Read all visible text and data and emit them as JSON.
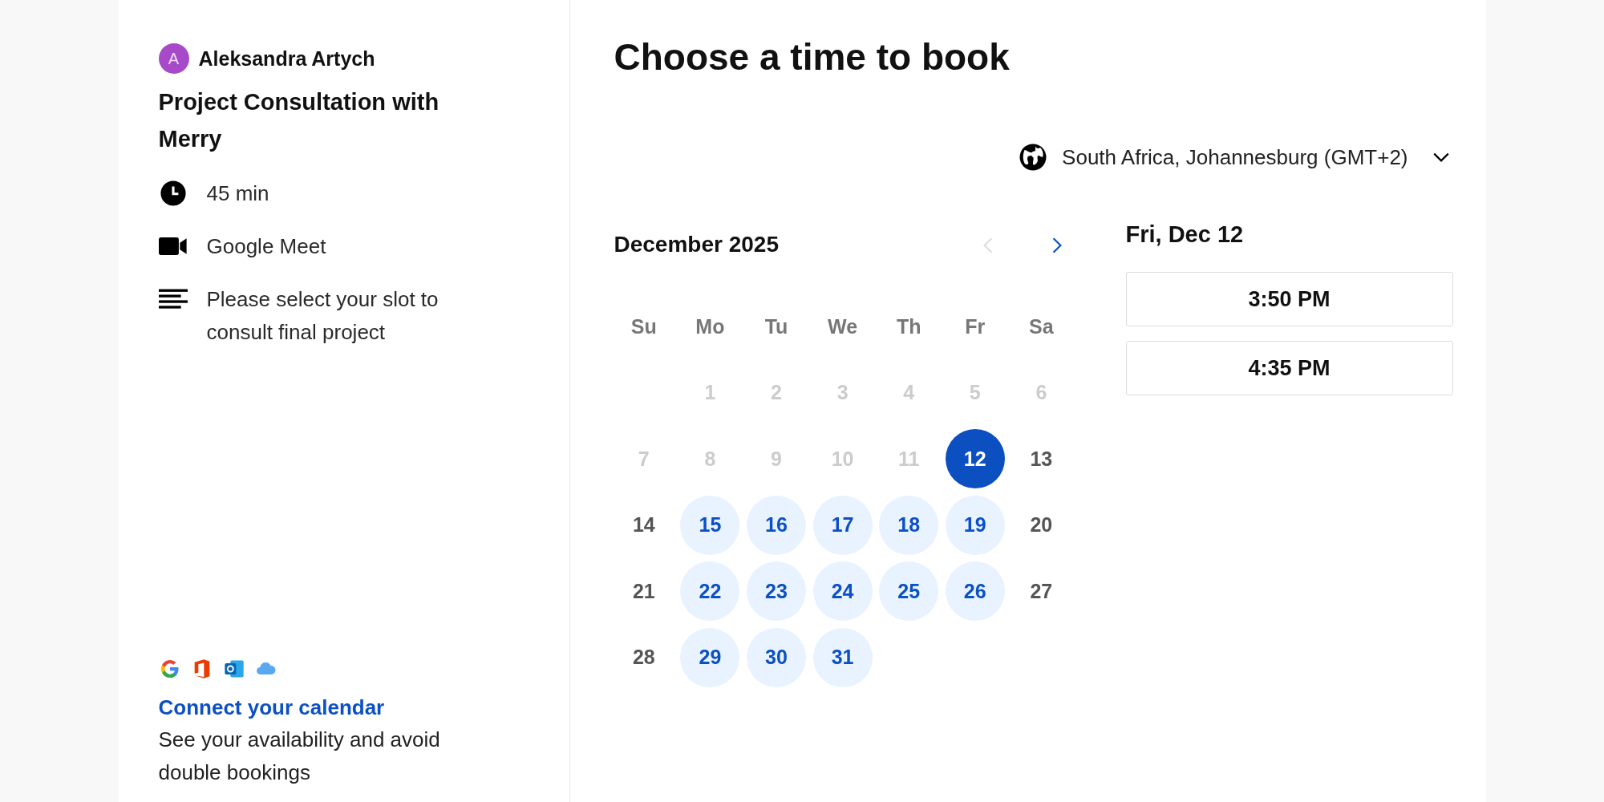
{
  "host": {
    "initial": "A",
    "name": "Aleksandra Artych"
  },
  "event": {
    "title": "Project Consultation with Merry",
    "details": [
      {
        "kind": "duration",
        "text": "45 min"
      },
      {
        "kind": "video",
        "text": "Google Meet"
      },
      {
        "kind": "description",
        "text": "Please select your slot to consult final project"
      }
    ]
  },
  "connect": {
    "link": "Connect your calendar",
    "text": "See your availability and avoid double bookings"
  },
  "heading": "Choose a time to book",
  "timezone": "South Africa, Johannesburg (GMT+2)",
  "calendar": {
    "month": "December 2025",
    "prev_disabled": true,
    "next_disabled": false,
    "weekdays": [
      "Su",
      "Mo",
      "Tu",
      "We",
      "Th",
      "Fr",
      "Sa"
    ],
    "weeks": [
      [
        {
          "kind": "blank"
        },
        {
          "label": "1",
          "kind": "past",
          "selected": false
        },
        {
          "label": "2",
          "kind": "past",
          "selected": false
        },
        {
          "label": "3",
          "kind": "past",
          "selected": false
        },
        {
          "label": "4",
          "kind": "past",
          "selected": false
        },
        {
          "label": "5",
          "kind": "past",
          "selected": false
        },
        {
          "label": "6",
          "kind": "past",
          "selected": false
        }
      ],
      [
        {
          "label": "7",
          "kind": "past",
          "selected": false
        },
        {
          "label": "8",
          "kind": "past",
          "selected": false
        },
        {
          "label": "9",
          "kind": "past",
          "selected": false
        },
        {
          "label": "10",
          "kind": "past",
          "selected": false
        },
        {
          "label": "11",
          "kind": "past",
          "selected": false
        },
        {
          "label": "12",
          "kind": "available",
          "selected": true
        },
        {
          "label": "13",
          "kind": "unavailable",
          "selected": false
        }
      ],
      [
        {
          "label": "14",
          "kind": "unavailable",
          "selected": false
        },
        {
          "label": "15",
          "kind": "available",
          "selected": false
        },
        {
          "label": "16",
          "kind": "available",
          "selected": false
        },
        {
          "label": "17",
          "kind": "available",
          "selected": false
        },
        {
          "label": "18",
          "kind": "available",
          "selected": false
        },
        {
          "label": "19",
          "kind": "available",
          "selected": false
        },
        {
          "label": "20",
          "kind": "unavailable",
          "selected": false
        }
      ],
      [
        {
          "label": "21",
          "kind": "unavailable",
          "selected": false
        },
        {
          "label": "22",
          "kind": "available",
          "selected": false
        },
        {
          "label": "23",
          "kind": "available",
          "selected": false
        },
        {
          "label": "24",
          "kind": "available",
          "selected": false
        },
        {
          "label": "25",
          "kind": "available",
          "selected": false
        },
        {
          "label": "26",
          "kind": "available",
          "selected": false
        },
        {
          "label": "27",
          "kind": "unavailable",
          "selected": false
        }
      ],
      [
        {
          "label": "28",
          "kind": "unavailable",
          "selected": false
        },
        {
          "label": "29",
          "kind": "available",
          "selected": false
        },
        {
          "label": "30",
          "kind": "available",
          "selected": false
        },
        {
          "label": "31",
          "kind": "available",
          "selected": false
        }
      ]
    ]
  },
  "slots": {
    "date": "Fri, Dec 12",
    "times": [
      "3:50 PM",
      "4:35 PM"
    ]
  }
}
